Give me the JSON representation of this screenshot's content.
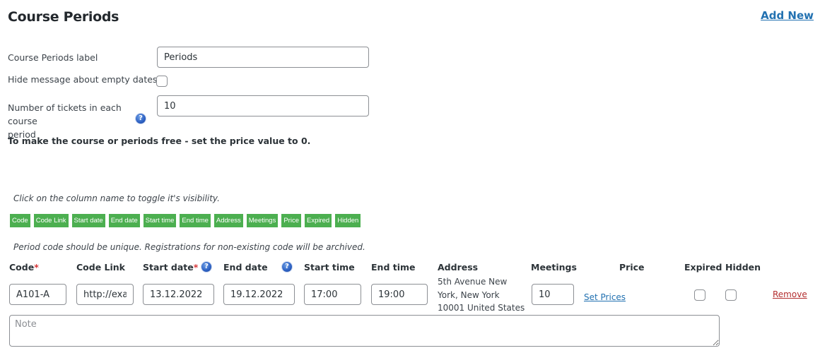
{
  "header": {
    "title": "Course Periods",
    "add_new_label": "Add New"
  },
  "settings": {
    "periods_label": {
      "label": "Course Periods label",
      "value": "Periods"
    },
    "hide_empty_dates": {
      "label": "Hide message about empty dates",
      "checked": false
    },
    "tickets": {
      "label_line1": "Number of tickets in each course",
      "label_line2": "period",
      "value": "10"
    },
    "free_note": "To make the course or periods free - set the price value to 0."
  },
  "columns_toggle": {
    "hint": "Click on the column name to toggle it's visibility.",
    "items": [
      "Code",
      "Code Link",
      "Start date",
      "End date",
      "Start time",
      "End time",
      "Address",
      "Meetings",
      "Price",
      "Expired",
      "Hidden"
    ],
    "color": "#4caf50"
  },
  "period_note": "Period code should be unique. Registrations for non-existing code will be archived.",
  "table": {
    "headers": {
      "code": "Code",
      "code_link": "Code Link",
      "start_date": "Start date",
      "end_date": "End date",
      "start_time": "Start time",
      "end_time": "End time",
      "address": "Address",
      "meetings": "Meetings",
      "price": "Price",
      "expired": "Expired",
      "hidden": "Hidden"
    },
    "required_mark": "*",
    "help_glyph": "?",
    "row": {
      "code": "A101-A",
      "code_link": "http://exa",
      "start_date": "13.12.2022",
      "end_date": "19.12.2022",
      "start_time": "17:00",
      "end_time": "19:00",
      "address_lines": [
        "5th Avenue New",
        "York, New York",
        "10001 United States"
      ],
      "meetings": "10",
      "set_prices_label": "Set Prices",
      "expired": false,
      "hidden": false,
      "remove_label": "Remove",
      "note_placeholder": "Note"
    }
  }
}
